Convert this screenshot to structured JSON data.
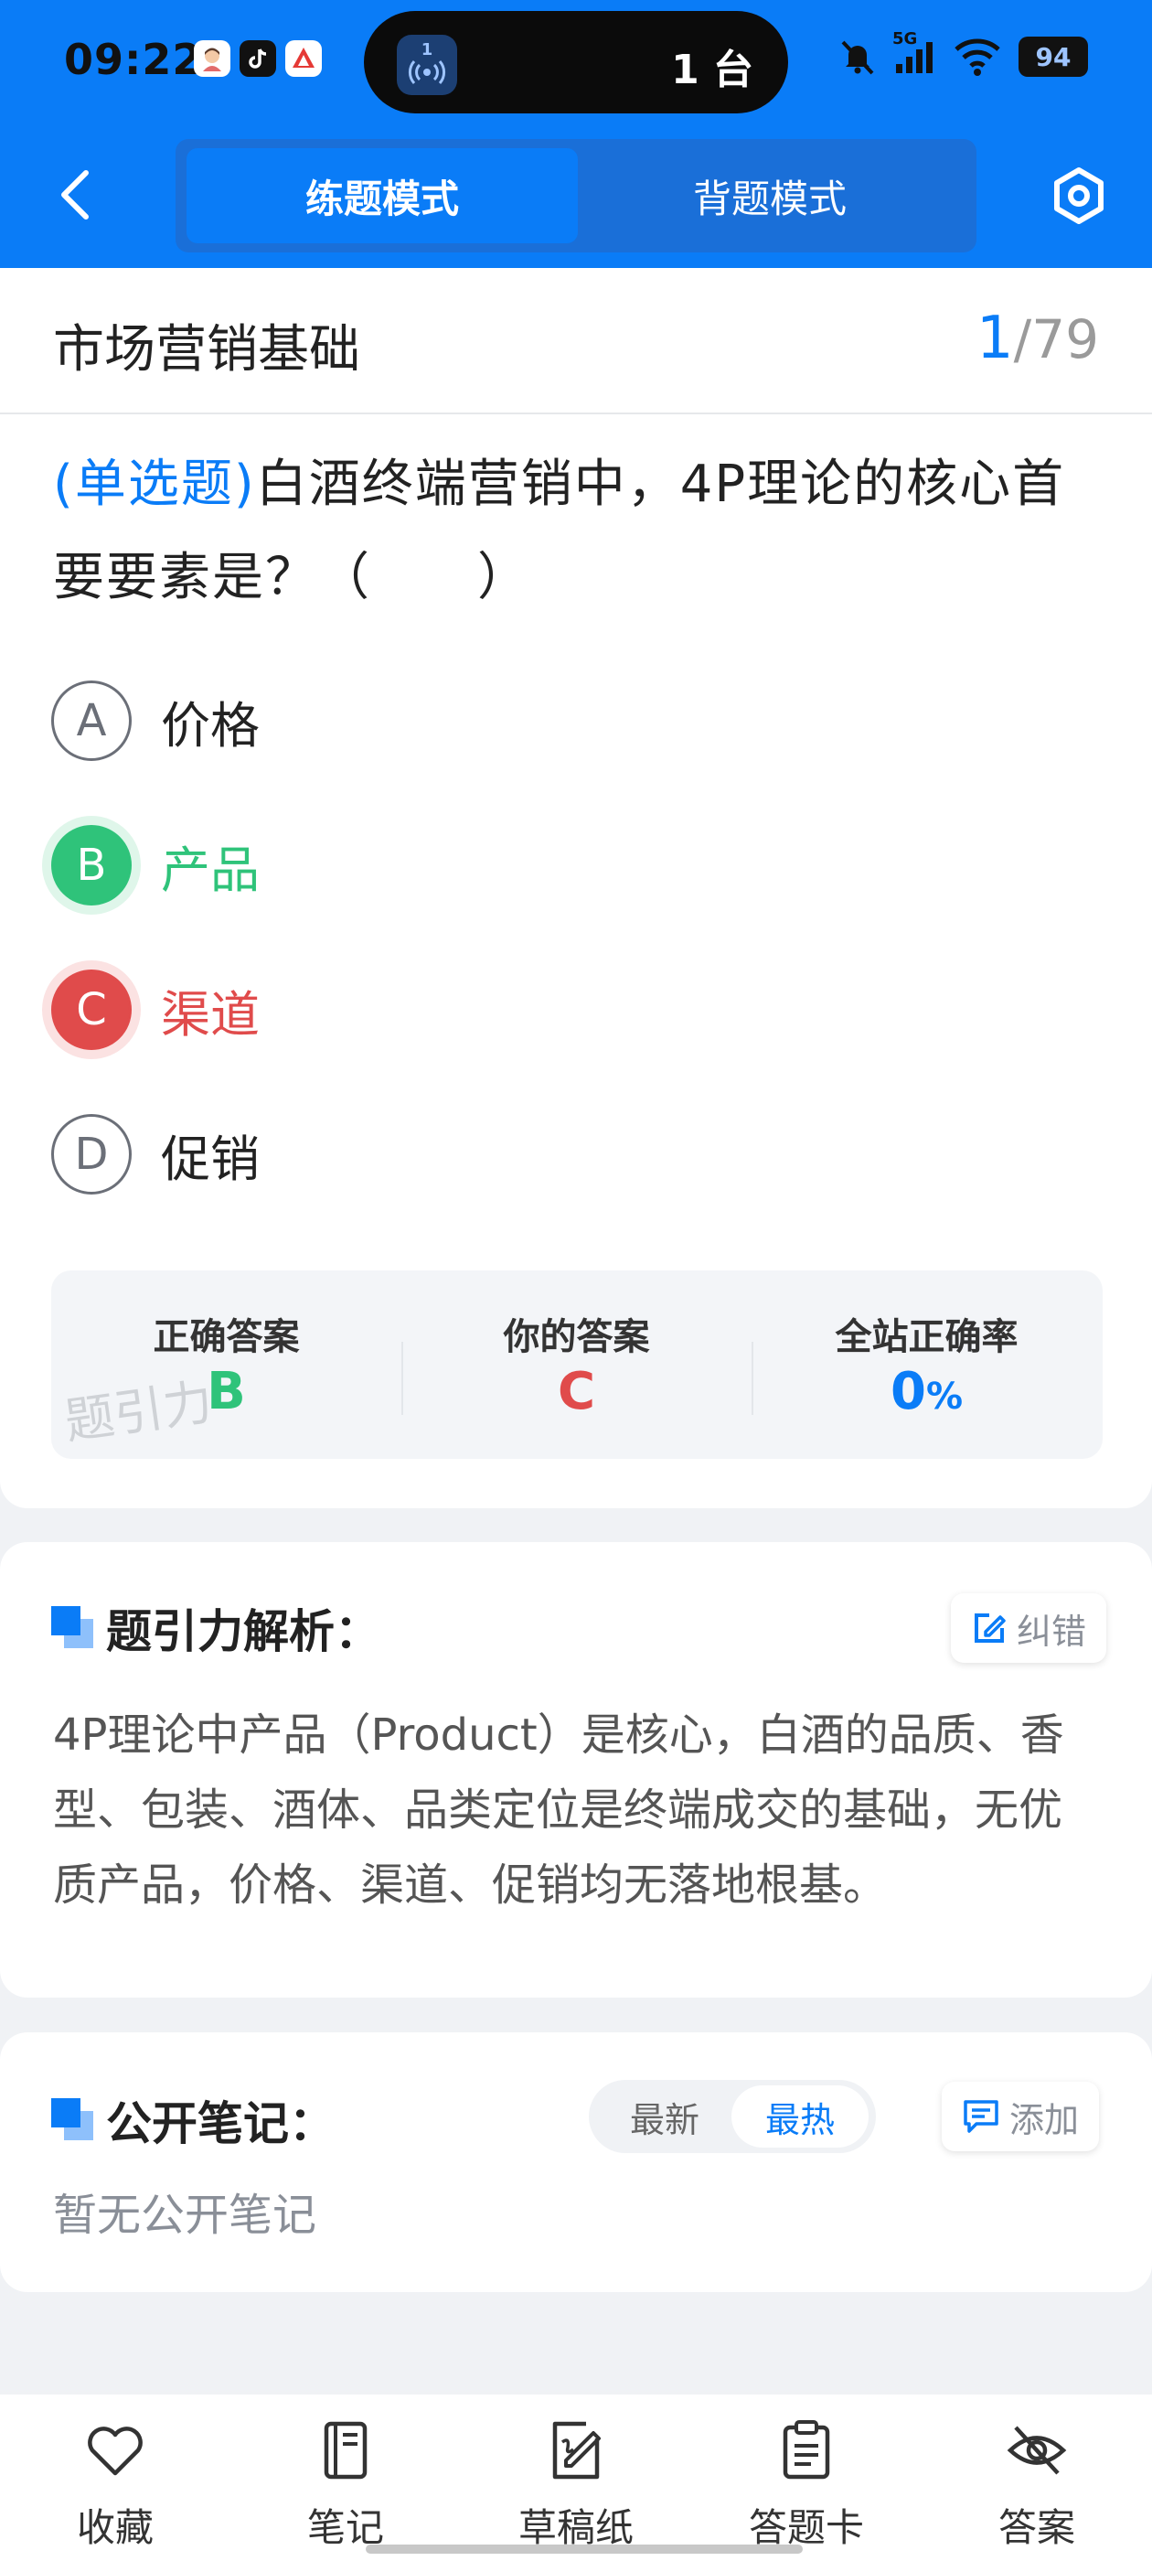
{
  "status_bar": {
    "time": "09:22",
    "island_icon_badge": "1",
    "island_text": "1 台",
    "network": "5G",
    "battery": "94"
  },
  "top_bar": {
    "tabs": [
      {
        "label": "练题模式",
        "active": true
      },
      {
        "label": "背题模式",
        "active": false
      }
    ]
  },
  "subject": {
    "title": "市场营销基础",
    "current": "1",
    "separator": "/",
    "total": "79"
  },
  "question": {
    "type": "(单选题)",
    "text": "白酒终端营销中，4P理论的核心首要要素是？（　　）"
  },
  "options": [
    {
      "letter": "A",
      "text": "价格",
      "state": "normal"
    },
    {
      "letter": "B",
      "text": "产品",
      "state": "correct"
    },
    {
      "letter": "C",
      "text": "渠道",
      "state": "wrong"
    },
    {
      "letter": "D",
      "text": "促销",
      "state": "normal"
    }
  ],
  "answer_panel": {
    "correct_label": "正确答案",
    "correct_value": "B",
    "yours_label": "你的答案",
    "yours_value": "C",
    "rate_label": "全站正确率",
    "rate_value": "0",
    "rate_unit": "%",
    "watermark": "题引力"
  },
  "analysis": {
    "title": "题引力解析：",
    "report_label": "纠错",
    "text": "4P理论中产品（Product）是核心，白酒的品质、香型、包装、酒体、品类定位是终端成交的基础，无优质产品，价格、渠道、促销均无落地根基。"
  },
  "notes": {
    "title": "公开笔记：",
    "sort_latest": "最新",
    "sort_hot": "最热",
    "add_label": "添加",
    "empty_text": "暂无公开笔记"
  },
  "bottom_nav": [
    {
      "label": "收藏",
      "icon": "heart-icon"
    },
    {
      "label": "笔记",
      "icon": "notebook-icon"
    },
    {
      "label": "草稿纸",
      "icon": "draft-icon"
    },
    {
      "label": "答题卡",
      "icon": "answer-sheet-icon"
    },
    {
      "label": "答案",
      "icon": "eye-off-icon"
    }
  ],
  "colors": {
    "primary": "#0a7cf7",
    "correct": "#2fc37a",
    "wrong": "#e04b4b"
  }
}
